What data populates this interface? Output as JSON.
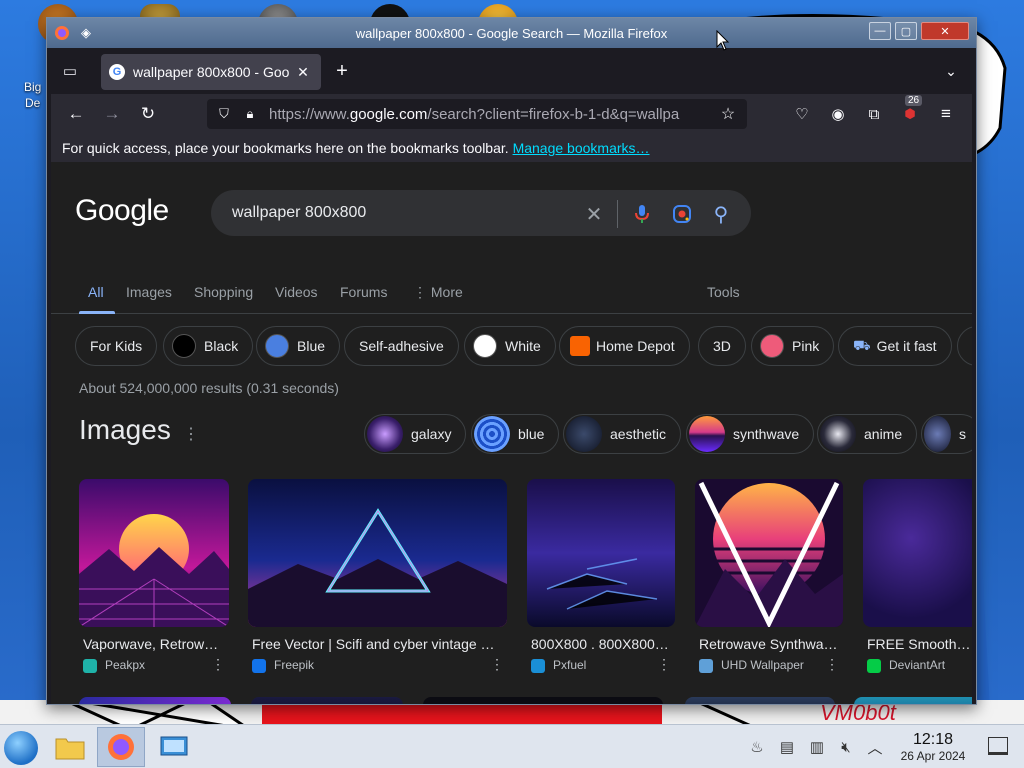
{
  "desktop": {
    "icon_label": "Big\nDe",
    "wallpaper_text": "VM0b0t"
  },
  "window": {
    "title": "wallpaper 800x800 - Google Search — Mozilla Firefox",
    "controls": {
      "minimize": "—",
      "maximize": "▢",
      "close": "✕"
    }
  },
  "browser": {
    "tab": {
      "title": "wallpaper 800x800 - Goo",
      "close": "✕"
    },
    "new_tab": "+",
    "url": {
      "prefix": "https://www.",
      "host": "google.com",
      "rest": "/search?client=firefox-b-1-d&q=wallpa"
    },
    "extension_badge": "26",
    "bookmarks_bar": {
      "text": "For quick access, place your bookmarks here on the bookmarks toolbar.",
      "link": "Manage bookmarks…"
    }
  },
  "google": {
    "logo": "Google",
    "query": "wallpaper 800x800",
    "tabs": [
      "All",
      "Images",
      "Shopping",
      "Videos",
      "Forums",
      "⋮ More",
      "Tools"
    ],
    "chips": [
      {
        "label": "For Kids",
        "swatch": null
      },
      {
        "label": "Black",
        "swatch": "#000000"
      },
      {
        "label": "Blue",
        "swatch": "#4a7fe0"
      },
      {
        "label": "Self-adhesive",
        "swatch": null
      },
      {
        "label": "White",
        "swatch": "#ffffff"
      },
      {
        "label": "Home Depot",
        "swatch": "#f96302"
      },
      {
        "label": "3D",
        "swatch": null
      },
      {
        "label": "Pink",
        "swatch": "#ee5b7a"
      },
      {
        "label": "Get it fast",
        "swatch": null
      }
    ],
    "results_stats": "About 524,000,000 results (0.31 seconds)",
    "images_heading": "Images",
    "image_chips": [
      "galaxy",
      "blue",
      "aesthetic",
      "synthwave",
      "anime",
      "s"
    ],
    "image_results": [
      {
        "title": "Vaporwave, Retrow…",
        "source": "Peakpx",
        "source_color": "#1fb3a9"
      },
      {
        "title": "Free Vector | Scifi and cyber vintage n…",
        "source": "Freepik",
        "source_color": "#1273eb"
      },
      {
        "title": "800X800 . 800X800…",
        "source": "Pxfuel",
        "source_color": "#1a8fd6"
      },
      {
        "title": "Retrowave Synthwa…",
        "source": "UHD Wallpaper",
        "source_color": "#5fa0d8"
      },
      {
        "title": "FREE Smooth Sp",
        "source": "DeviantArt",
        "source_color": "#05cc47"
      }
    ]
  },
  "taskbar": {
    "time": "12:18",
    "date": "26 Apr 2024"
  }
}
